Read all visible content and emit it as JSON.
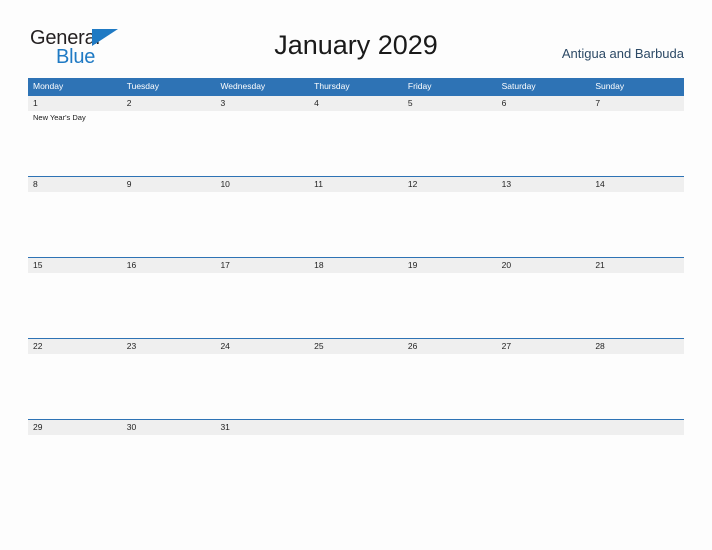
{
  "brand": {
    "name_part1": "General",
    "name_part2": "Blue",
    "flag_color": "#1f7ac4"
  },
  "header": {
    "title": "January 2029",
    "subtitle": "Antigua and Barbuda"
  },
  "theme": {
    "header_blue": "#2e73b5",
    "band_gray": "#efefef",
    "text_dark": "#232323",
    "subtitle_color": "#2d4a66",
    "page_background": "#fdfdfd"
  },
  "calendar": {
    "weekdays": [
      "Monday",
      "Tuesday",
      "Wednesday",
      "Thursday",
      "Friday",
      "Saturday",
      "Sunday"
    ],
    "weeks": [
      {
        "days": [
          {
            "date": "1",
            "events": [
              "New Year's Day"
            ]
          },
          {
            "date": "2",
            "events": []
          },
          {
            "date": "3",
            "events": []
          },
          {
            "date": "4",
            "events": []
          },
          {
            "date": "5",
            "events": []
          },
          {
            "date": "6",
            "events": []
          },
          {
            "date": "7",
            "events": []
          }
        ]
      },
      {
        "days": [
          {
            "date": "8",
            "events": []
          },
          {
            "date": "9",
            "events": []
          },
          {
            "date": "10",
            "events": []
          },
          {
            "date": "11",
            "events": []
          },
          {
            "date": "12",
            "events": []
          },
          {
            "date": "13",
            "events": []
          },
          {
            "date": "14",
            "events": []
          }
        ]
      },
      {
        "days": [
          {
            "date": "15",
            "events": []
          },
          {
            "date": "16",
            "events": []
          },
          {
            "date": "17",
            "events": []
          },
          {
            "date": "18",
            "events": []
          },
          {
            "date": "19",
            "events": []
          },
          {
            "date": "20",
            "events": []
          },
          {
            "date": "21",
            "events": []
          }
        ]
      },
      {
        "days": [
          {
            "date": "22",
            "events": []
          },
          {
            "date": "23",
            "events": []
          },
          {
            "date": "24",
            "events": []
          },
          {
            "date": "25",
            "events": []
          },
          {
            "date": "26",
            "events": []
          },
          {
            "date": "27",
            "events": []
          },
          {
            "date": "28",
            "events": []
          }
        ]
      },
      {
        "days": [
          {
            "date": "29",
            "events": []
          },
          {
            "date": "30",
            "events": []
          },
          {
            "date": "31",
            "events": []
          },
          {
            "date": "",
            "events": []
          },
          {
            "date": "",
            "events": []
          },
          {
            "date": "",
            "events": []
          },
          {
            "date": "",
            "events": []
          }
        ]
      }
    ]
  }
}
